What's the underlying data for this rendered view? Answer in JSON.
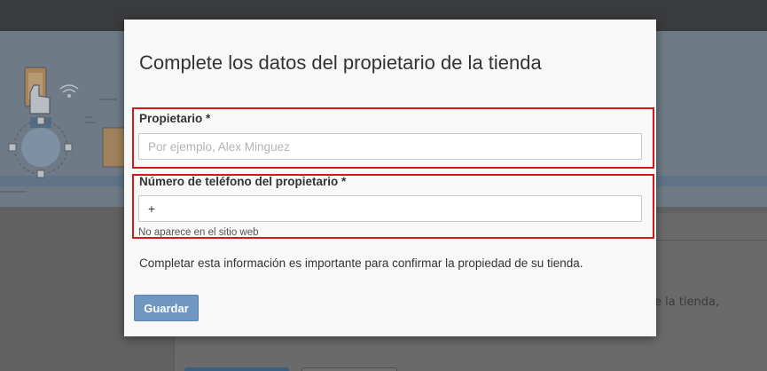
{
  "modal": {
    "title": "Complete los datos del propietario de la tienda",
    "owner_label": "Propietario *",
    "owner_placeholder": "Por ejemplo, Alex Minguez",
    "phone_label": "Número de teléfono del propietario *",
    "phone_value": "+",
    "phone_hint": "No aparece en el sitio web",
    "note": "Completar esta información es importante para confirmar la propiedad de su tienda.",
    "save_label": "Guardar"
  },
  "background": {
    "partial_text": "e la tienda,"
  },
  "colors": {
    "highlight": "#d9161c",
    "save_button": "#6f97c2",
    "overlay": "#5e5e5e"
  }
}
